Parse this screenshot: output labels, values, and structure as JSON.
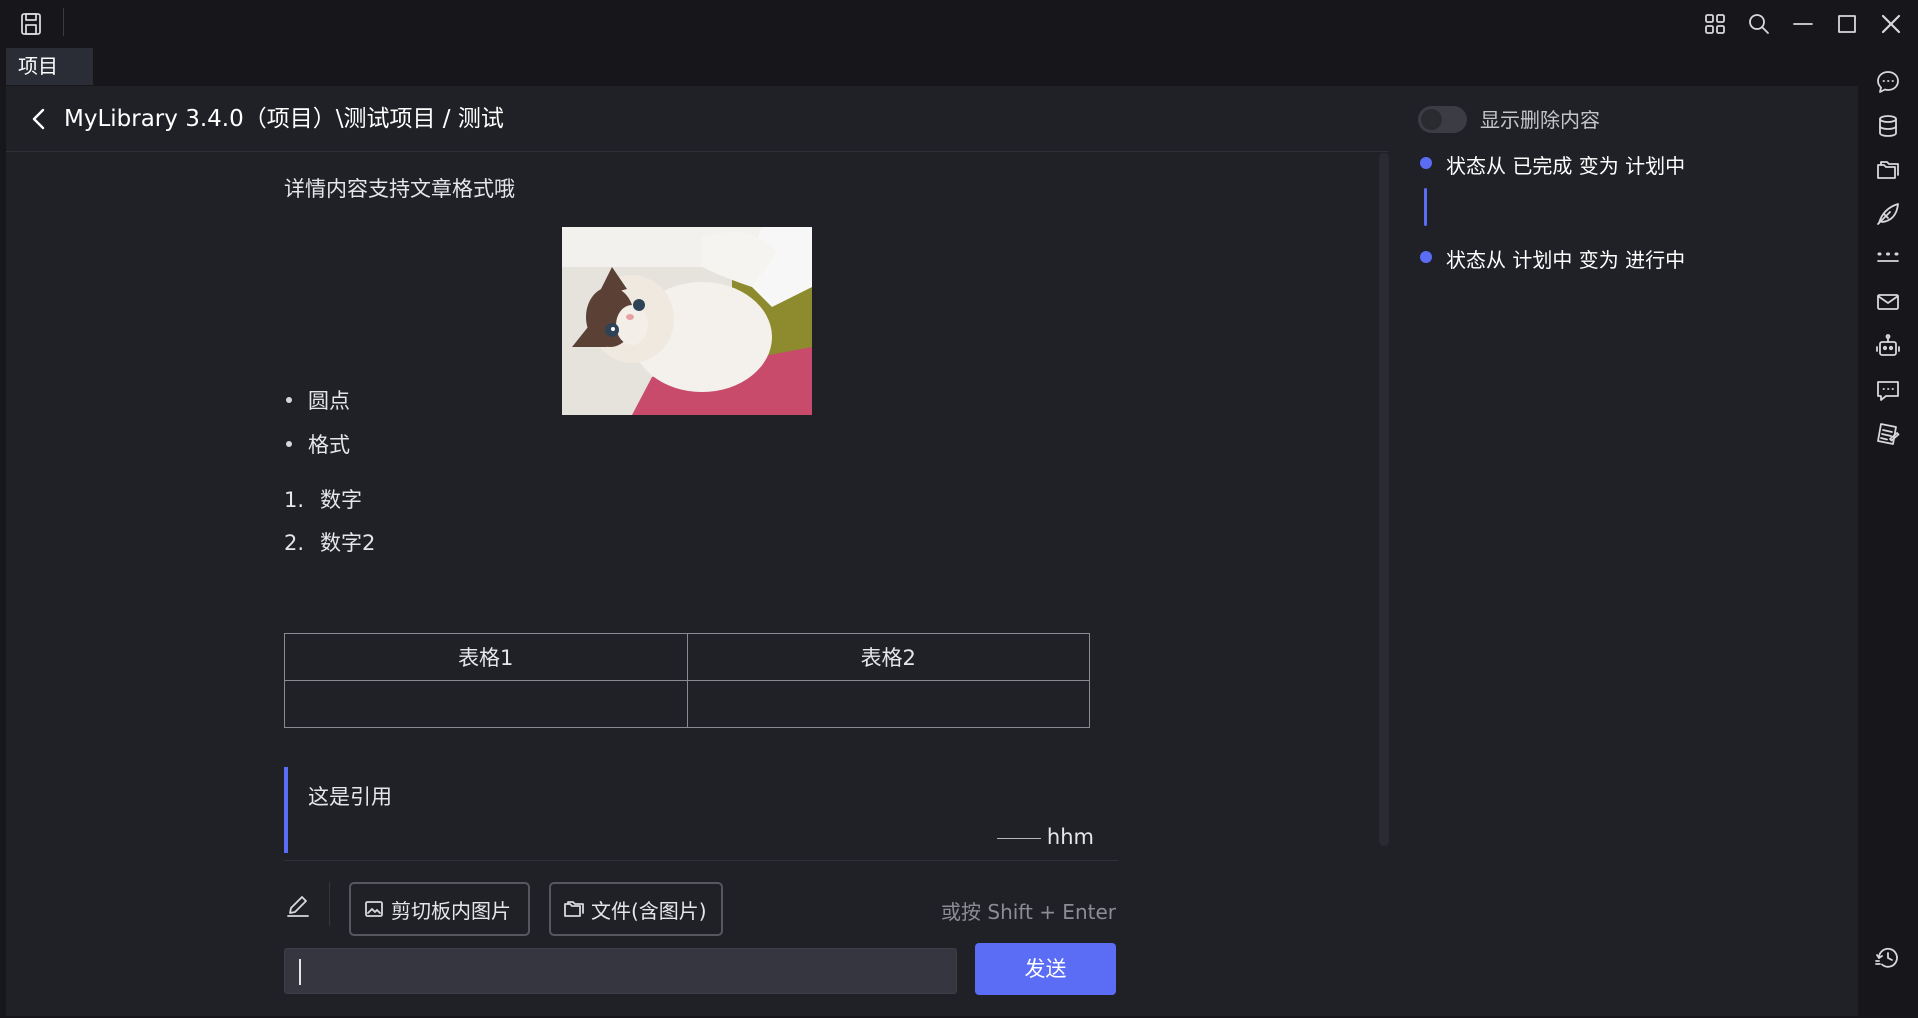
{
  "titlebar": {
    "icons": [
      "save-icon",
      "grid-icon",
      "search-icon",
      "minimize-icon",
      "maximize-icon",
      "close-icon"
    ]
  },
  "tabs": [
    {
      "label": "项目"
    }
  ],
  "header": {
    "breadcrumb": "MyLibrary 3.4.0（项目）\\测试项目 / 测试"
  },
  "content": {
    "intro": "详情内容支持文章格式哦",
    "bullets": [
      "圆点",
      "格式"
    ],
    "numbered": [
      {
        "num": "1.",
        "text": "数字"
      },
      {
        "num": "2.",
        "text": "数字2"
      }
    ],
    "table": {
      "headers": [
        "表格1",
        "表格2"
      ],
      "rows": [
        [
          "",
          ""
        ]
      ]
    },
    "quote": {
      "text": "这是引用",
      "author": "hhm"
    }
  },
  "editor": {
    "clipboard_button": "剪切板内图片",
    "file_button": "文件(含图片)",
    "hint": "或按 Shift + Enter",
    "input_value": "",
    "send_button": "发送"
  },
  "history": {
    "toggle_label": "显示删除内容",
    "toggle_on": false,
    "entries": [
      {
        "text": "状态从 已完成 变为 计划中"
      },
      {
        "text": "状态从 计划中 变为 进行中"
      }
    ]
  },
  "sidebar": {
    "icons": [
      "comment-icon",
      "database-icon",
      "folders-icon",
      "leaf-icon",
      "more-icon",
      "mail-icon",
      "robot-icon",
      "message-icon",
      "notes-icon",
      "history-icon"
    ]
  },
  "colors": {
    "accent": "#5b6cf5",
    "background": "#16161b",
    "panel": "#202127"
  }
}
